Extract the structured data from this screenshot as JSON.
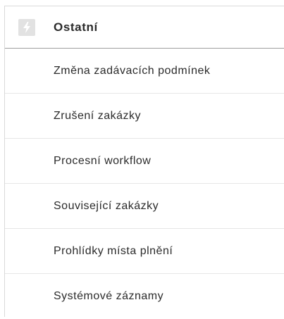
{
  "section": {
    "title": "Ostatní",
    "icon": "lightning-bolt-icon"
  },
  "menu": {
    "items": [
      {
        "label": "Změna zadávacích podmínek"
      },
      {
        "label": "Zrušení zakázky"
      },
      {
        "label": "Procesní workflow"
      },
      {
        "label": "Související zakázky"
      },
      {
        "label": "Prohlídky místa plnění"
      },
      {
        "label": "Systémové záznamy"
      }
    ]
  },
  "colors": {
    "icon_background": "#e2e2e2",
    "icon_glyph": "#ffffff",
    "text": "#2b2b2b",
    "divider": "#e6e6e6",
    "header_divider": "#9e9e9e"
  }
}
